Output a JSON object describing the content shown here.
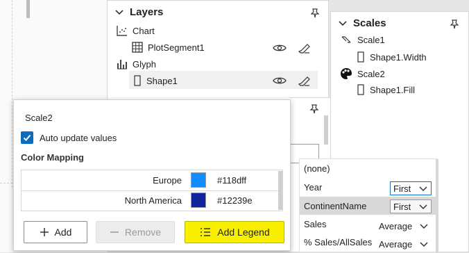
{
  "layers": {
    "title": "Layers",
    "items": [
      {
        "label": "Chart"
      },
      {
        "label": "PlotSegment1"
      },
      {
        "label": "Glyph"
      },
      {
        "label": "Shape1"
      }
    ]
  },
  "scales": {
    "title": "Scales",
    "items": [
      {
        "label": "Scale1"
      },
      {
        "label": "Shape1.Width"
      },
      {
        "label": "Scale2"
      },
      {
        "label": "Shape1.Fill"
      }
    ]
  },
  "scale_popup": {
    "name": "Scale2",
    "auto_update_label": "Auto update values",
    "section_title": "Color Mapping",
    "rows": [
      {
        "label": "Europe",
        "color": "#118dff",
        "hex": "#118dff"
      },
      {
        "label": "North America",
        "color": "#12239e",
        "hex": "#12239e"
      }
    ],
    "buttons": {
      "add": "Add",
      "remove": "Remove",
      "add_legend": "Add Legend"
    }
  },
  "field_list": {
    "items": [
      {
        "label": "(none)",
        "agg": ""
      },
      {
        "label": "Year",
        "agg": "First"
      },
      {
        "label": "ContinentName",
        "agg": "First"
      },
      {
        "label": "Sales",
        "agg": "Average"
      },
      {
        "label": "% Sales/AllSales",
        "agg": "Average"
      }
    ]
  },
  "colors": {
    "accent": "#0f6cbd",
    "highlight": "#f9f000"
  }
}
